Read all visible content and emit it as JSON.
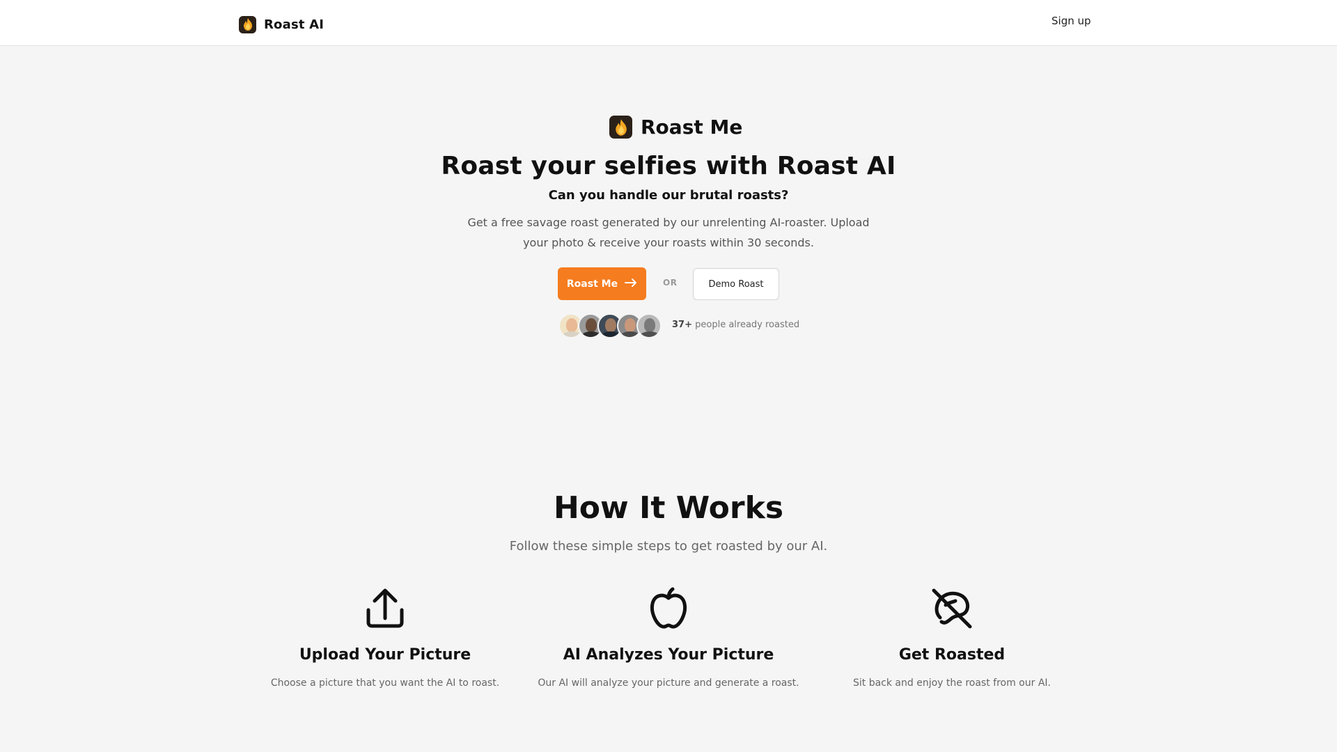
{
  "header": {
    "brand_name": "Roast AI",
    "signup_label": "Sign up"
  },
  "hero": {
    "badge_text": "Roast Me",
    "title": "Roast your selfies with Roast AI",
    "subtitle": "Can you handle our brutal roasts?",
    "description": "Get a free savage roast generated by our unrelenting AI-roaster. Upload your photo & receive your roasts within 30 seconds.",
    "primary_button": "Roast Me",
    "or_label": "OR",
    "secondary_button": "Demo Roast",
    "social_count": "37+",
    "social_text": "people already roasted"
  },
  "how_it_works": {
    "title": "How It Works",
    "subtitle": "Follow these simple steps to get roasted by our AI.",
    "steps": [
      {
        "icon": "upload-icon",
        "title": "Upload Your Picture",
        "description": "Choose a picture that you want the AI to roast."
      },
      {
        "icon": "apple-icon",
        "title": "AI Analyzes Your Picture",
        "description": "Our AI will analyze your picture and generate a roast."
      },
      {
        "icon": "bean-off-icon",
        "title": "Get Roasted",
        "description": "Sit back and enjoy the roast from our AI."
      }
    ]
  },
  "colors": {
    "accent": "#f57c1f",
    "background": "#f5f5f5",
    "header_bg": "#ffffff"
  }
}
